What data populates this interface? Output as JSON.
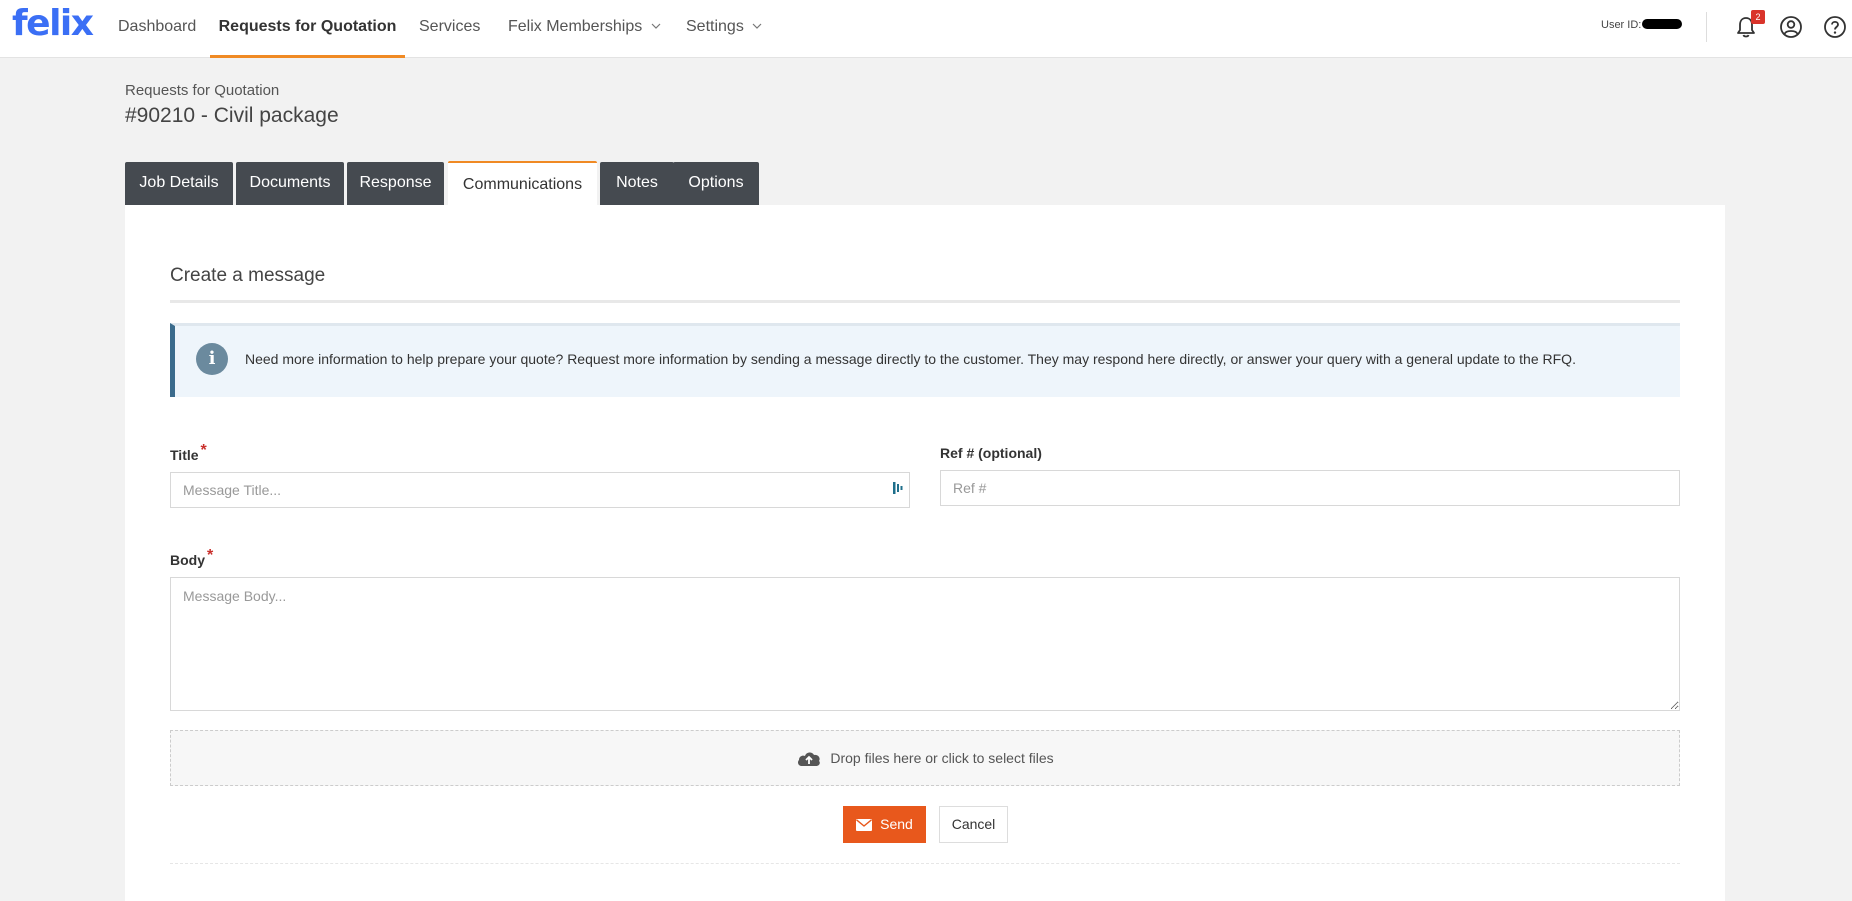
{
  "app": {
    "logo": "felix"
  },
  "nav": {
    "items": [
      {
        "label": "Dashboard"
      },
      {
        "label": "Requests for Quotation",
        "active": true
      },
      {
        "label": "Services"
      },
      {
        "label": "Felix Memberships",
        "dropdown": true
      },
      {
        "label": "Settings",
        "dropdown": true
      }
    ],
    "user_id_label": "User ID:",
    "notification_count": "2",
    "icons": [
      "bell-icon",
      "user-circle-icon",
      "help-circle-icon"
    ]
  },
  "header": {
    "breadcrumb": "Requests for Quotation",
    "title": "#90210 - Civil package"
  },
  "tabs": [
    {
      "label": "Job Details"
    },
    {
      "label": "Documents"
    },
    {
      "label": "Response"
    },
    {
      "label": "Communications",
      "active": true
    },
    {
      "label": "Notes"
    },
    {
      "label": "Options"
    }
  ],
  "form": {
    "heading": "Create a message",
    "info_text": "Need more information to help prepare your quote? Request more information by sending a message directly to the customer. They may respond here directly, or answer your query with a general update to the RFQ.",
    "title_label": "Title",
    "title_placeholder": "Message Title...",
    "ref_label": "Ref # (optional)",
    "ref_placeholder": "Ref #",
    "body_label": "Body",
    "body_placeholder": "Message Body...",
    "required_mark": "*",
    "dropzone_text": "Drop files here or click to select files",
    "send_label": "Send",
    "cancel_label": "Cancel"
  },
  "colors": {
    "brand_blue": "#3b6ff5",
    "accent_orange": "#f08a24",
    "send_button": "#e8581c",
    "tab_dark": "#454a50",
    "badge_red": "#d9342b",
    "info_bar": "#3b6b8c"
  }
}
